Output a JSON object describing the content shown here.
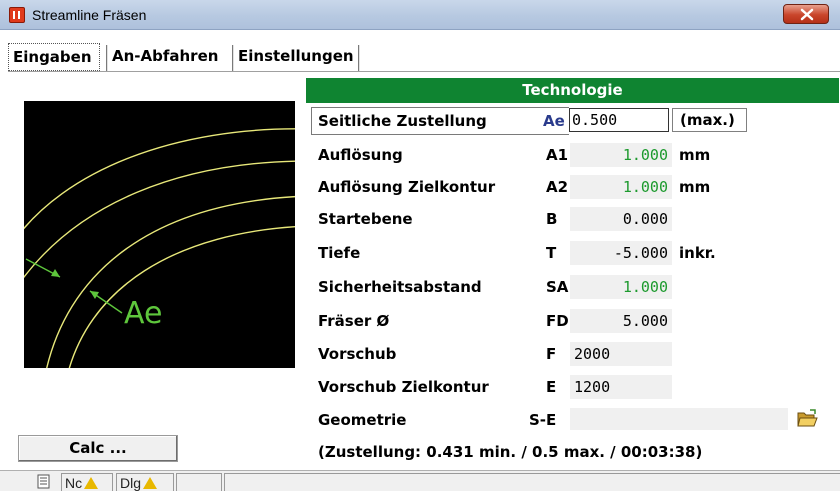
{
  "window": {
    "title": "Streamline Fräsen"
  },
  "tabs": [
    {
      "label": "Eingaben",
      "active": true
    },
    {
      "label": "An-Abfahren",
      "active": false
    },
    {
      "label": "Einstellungen",
      "active": false
    }
  ],
  "preview": {
    "label": "Ae"
  },
  "technology": {
    "header": "Technologie"
  },
  "rows": [
    {
      "label": "Seitliche Zustellung",
      "code": "Ae",
      "value": "0.500",
      "unit": "(max.)"
    },
    {
      "label": "Auflösung",
      "code": "A1",
      "value": "1.000",
      "unit": "mm"
    },
    {
      "label": "Auflösung Zielkontur",
      "code": "A2",
      "value": "1.000",
      "unit": "mm"
    },
    {
      "label": "Startebene",
      "code": "B",
      "value": "0.000",
      "unit": ""
    },
    {
      "label": "Tiefe",
      "code": "T",
      "value": "-5.000",
      "unit": "inkr."
    },
    {
      "label": "Sicherheitsabstand",
      "code": "SA",
      "value": "1.000",
      "unit": ""
    },
    {
      "label": "Fräser Ø",
      "code": "FD",
      "value": "5.000",
      "unit": ""
    },
    {
      "label": "Vorschub",
      "code": "F",
      "value": "2000",
      "unit": ""
    },
    {
      "label": "Vorschub Zielkontur",
      "code": "E",
      "value": "1200",
      "unit": ""
    },
    {
      "label": "Geometrie",
      "code": "S-E",
      "value": "",
      "unit": ""
    }
  ],
  "calc_button": "Calc ...",
  "status": "(Zustellung: 0.431 min. / 0.5 max. / 00:03:38)",
  "statusbar": {
    "nc": "Nc",
    "dlg": "Dlg"
  },
  "colors": {
    "header_green": "#0f8431",
    "value_green": "#1d9a2e",
    "ae_blue": "#2a3b8c",
    "preview_line": "#e8e87a",
    "preview_arrow": "#5ec63c"
  }
}
